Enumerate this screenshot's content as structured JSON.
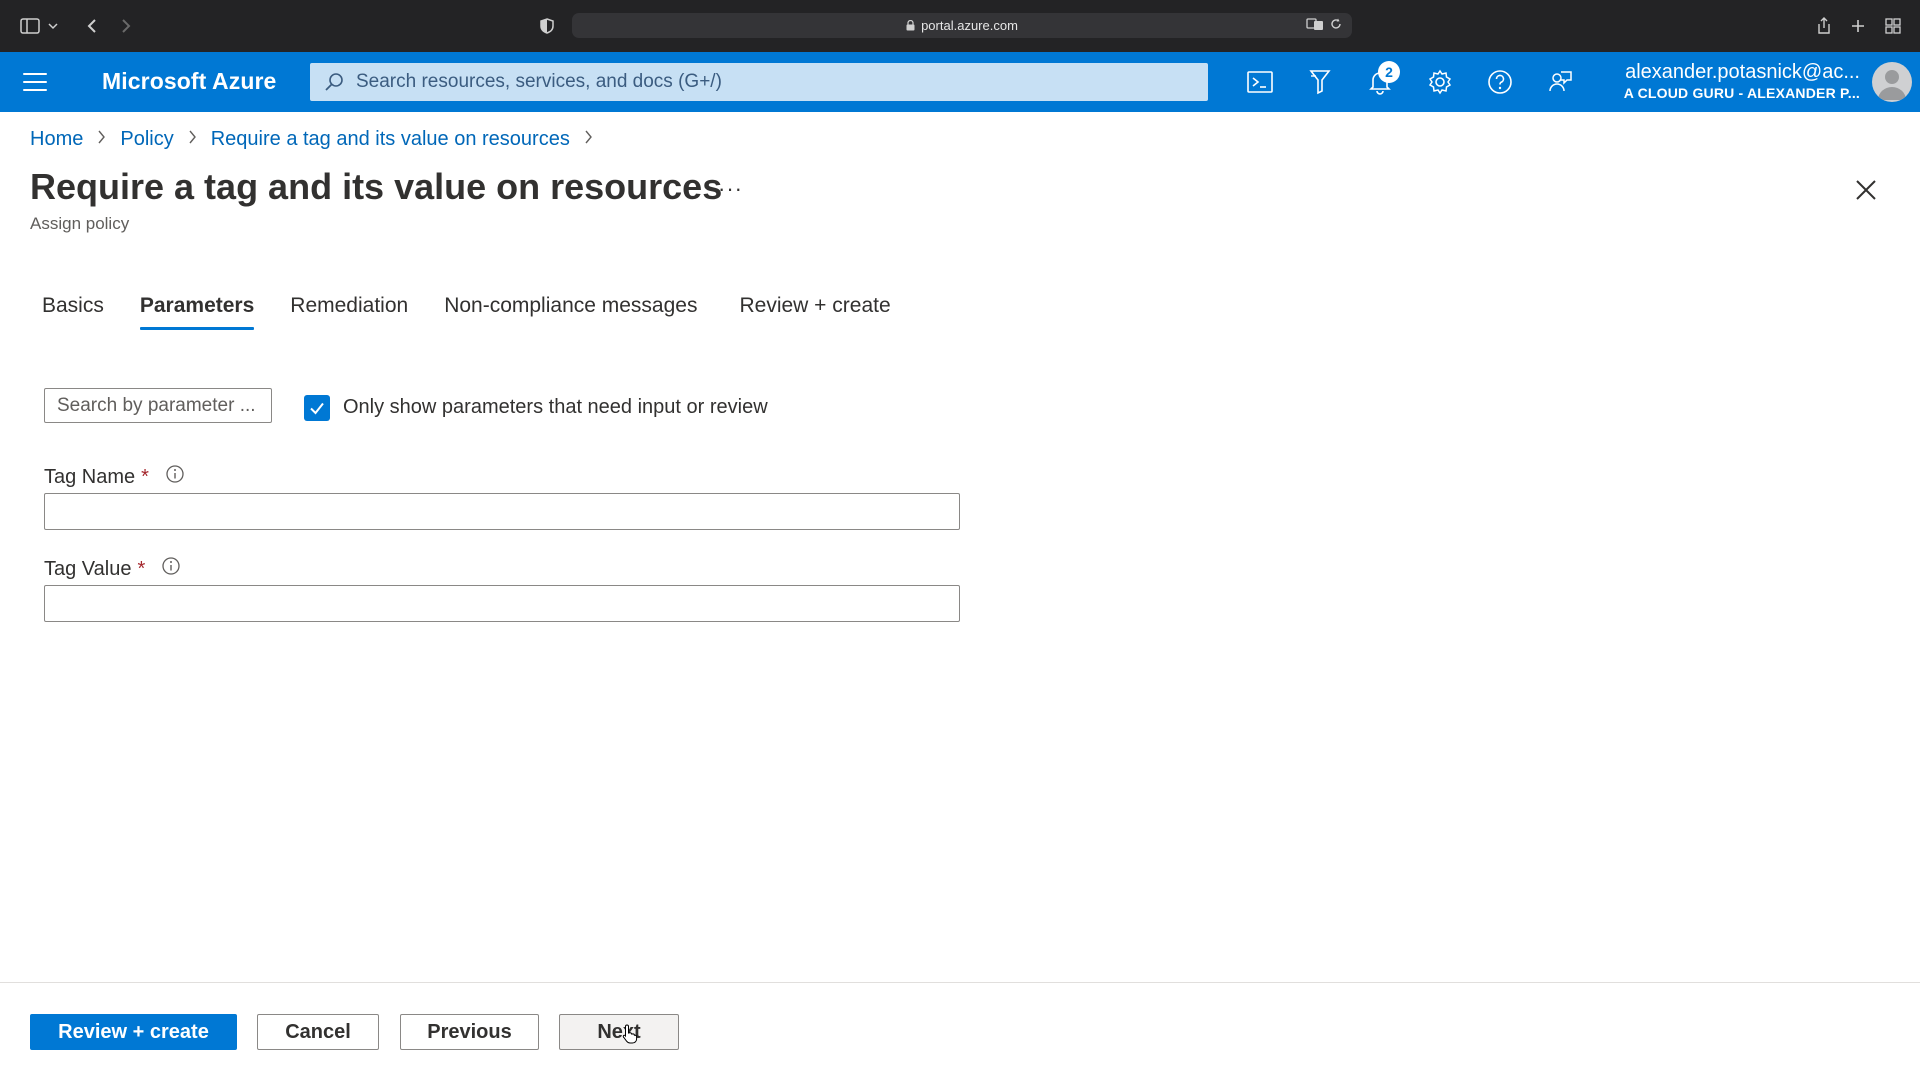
{
  "browser": {
    "url": "portal.azure.com"
  },
  "header": {
    "brand": "Microsoft Azure",
    "search_placeholder": "Search resources, services, and docs (G+/)",
    "notification_count": "2",
    "account_name": "alexander.potasnick@ac...",
    "account_directory": "A CLOUD GURU - ALEXANDER P..."
  },
  "breadcrumb": {
    "items": [
      "Home",
      "Policy",
      "Require a tag and its value on resources"
    ],
    "separator": ">"
  },
  "page": {
    "title": "Require a tag and its value on resources",
    "ellipsis": "···",
    "subtitle": "Assign policy"
  },
  "tabs": [
    {
      "label": "Basics",
      "active": false
    },
    {
      "label": "Parameters",
      "active": true
    },
    {
      "label": "Remediation",
      "active": false
    },
    {
      "label": "Non-compliance messages",
      "active": false
    },
    {
      "label": "Review + create",
      "active": false
    }
  ],
  "filters": {
    "search_placeholder": "Search by parameter ...",
    "only_show_label": "Only show parameters that need input or review",
    "only_show_checked": true
  },
  "fields": [
    {
      "label": "Tag Name",
      "required_mark": "*",
      "value": ""
    },
    {
      "label": "Tag Value",
      "required_mark": "*",
      "value": ""
    }
  ],
  "footer": {
    "review_create": "Review + create",
    "cancel": "Cancel",
    "previous": "Previous",
    "next": "Next"
  },
  "colors": {
    "azure_blue": "#0078d4",
    "link": "#0067b8",
    "required": "#a4262c"
  }
}
